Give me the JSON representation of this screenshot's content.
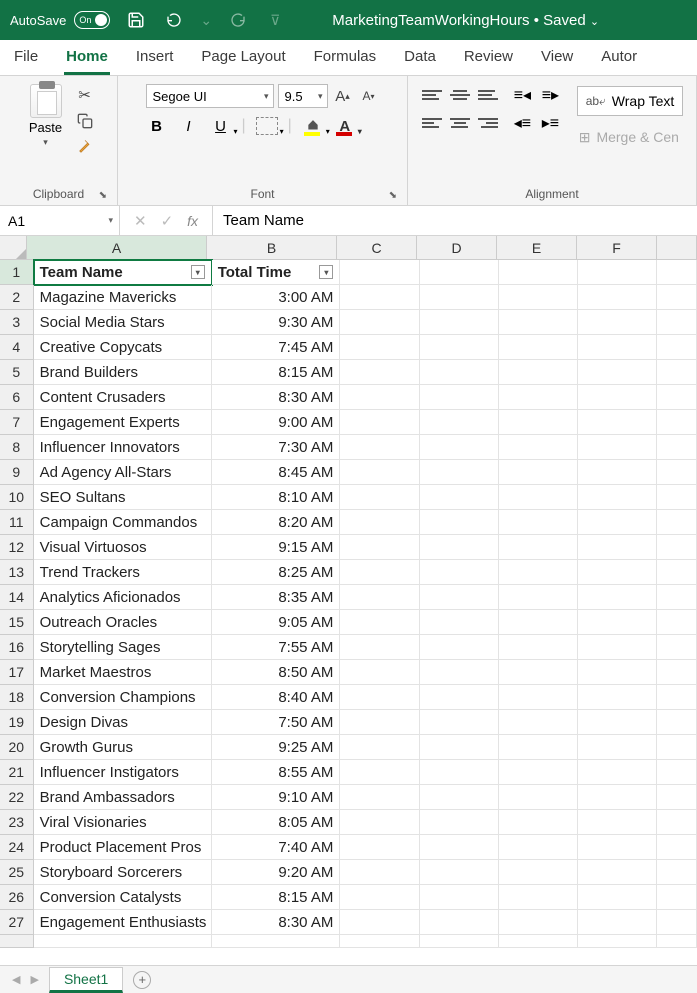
{
  "titlebar": {
    "autosave_label": "AutoSave",
    "autosave_on": "On",
    "doc_title": "MarketingTeamWorkingHours • Saved"
  },
  "tabs": [
    "File",
    "Home",
    "Insert",
    "Page Layout",
    "Formulas",
    "Data",
    "Review",
    "View",
    "Autor"
  ],
  "active_tab": 1,
  "ribbon": {
    "clipboard": {
      "paste": "Paste",
      "label": "Clipboard"
    },
    "font": {
      "name": "Segoe UI",
      "size": "9.5",
      "label": "Font",
      "bold": "B",
      "italic": "I",
      "underline": "U"
    },
    "alignment": {
      "wrap": "Wrap Text",
      "merge": "Merge & Cen",
      "label": "Alignment"
    }
  },
  "name_box": "A1",
  "formula_value": "Team Name",
  "columns": [
    "A",
    "B",
    "C",
    "D",
    "E",
    "F"
  ],
  "header_row": {
    "team": "Team Name",
    "time": "Total Time"
  },
  "rows": [
    {
      "n": 2,
      "team": "Magazine Mavericks",
      "time": "3:00 AM"
    },
    {
      "n": 3,
      "team": "Social Media Stars",
      "time": "9:30 AM"
    },
    {
      "n": 4,
      "team": "Creative Copycats",
      "time": "7:45 AM"
    },
    {
      "n": 5,
      "team": "Brand Builders",
      "time": "8:15 AM"
    },
    {
      "n": 6,
      "team": "Content Crusaders",
      "time": "8:30 AM"
    },
    {
      "n": 7,
      "team": "Engagement Experts",
      "time": "9:00 AM"
    },
    {
      "n": 8,
      "team": "Influencer Innovators",
      "time": "7:30 AM"
    },
    {
      "n": 9,
      "team": "Ad Agency All-Stars",
      "time": "8:45 AM"
    },
    {
      "n": 10,
      "team": "SEO Sultans",
      "time": "8:10 AM"
    },
    {
      "n": 11,
      "team": "Campaign Commandos",
      "time": "8:20 AM"
    },
    {
      "n": 12,
      "team": "Visual Virtuosos",
      "time": "9:15 AM"
    },
    {
      "n": 13,
      "team": "Trend Trackers",
      "time": "8:25 AM"
    },
    {
      "n": 14,
      "team": "Analytics Aficionados",
      "time": "8:35 AM"
    },
    {
      "n": 15,
      "team": "Outreach Oracles",
      "time": "9:05 AM"
    },
    {
      "n": 16,
      "team": "Storytelling Sages",
      "time": "7:55 AM"
    },
    {
      "n": 17,
      "team": "Market Maestros",
      "time": "8:50 AM"
    },
    {
      "n": 18,
      "team": "Conversion Champions",
      "time": "8:40 AM"
    },
    {
      "n": 19,
      "team": "Design Divas",
      "time": "7:50 AM"
    },
    {
      "n": 20,
      "team": "Growth Gurus",
      "time": "9:25 AM"
    },
    {
      "n": 21,
      "team": "Influencer Instigators",
      "time": "8:55 AM"
    },
    {
      "n": 22,
      "team": "Brand Ambassadors",
      "time": "9:10 AM"
    },
    {
      "n": 23,
      "team": "Viral Visionaries",
      "time": "8:05 AM"
    },
    {
      "n": 24,
      "team": "Product Placement Pros",
      "time": "7:40 AM"
    },
    {
      "n": 25,
      "team": "Storyboard Sorcerers",
      "time": "9:20 AM"
    },
    {
      "n": 26,
      "team": "Conversion Catalysts",
      "time": "8:15 AM"
    },
    {
      "n": 27,
      "team": "Engagement Enthusiasts",
      "time": "8:30 AM"
    }
  ],
  "sheet": {
    "name": "Sheet1"
  }
}
